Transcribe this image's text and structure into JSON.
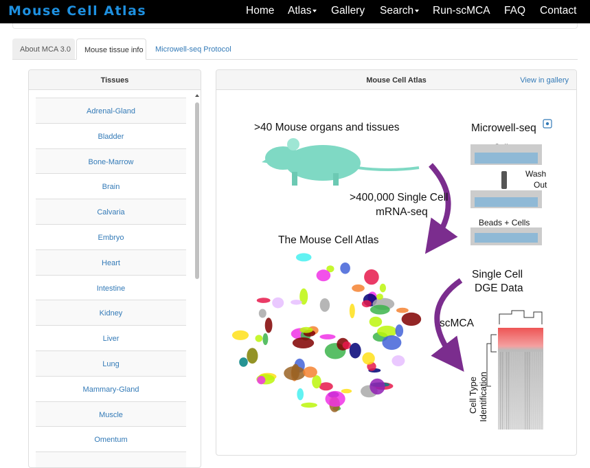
{
  "navbar": {
    "brand": "Mouse Cell Atlas",
    "items": [
      {
        "label": "Home",
        "dropdown": false
      },
      {
        "label": "Atlas",
        "dropdown": true
      },
      {
        "label": "Gallery",
        "dropdown": false
      },
      {
        "label": "Search",
        "dropdown": true
      },
      {
        "label": "Run-scMCA",
        "dropdown": false
      },
      {
        "label": "FAQ",
        "dropdown": false
      },
      {
        "label": "Contact",
        "dropdown": false
      }
    ]
  },
  "tabs": [
    {
      "label": "About MCA 3.0",
      "active": false
    },
    {
      "label": "Mouse tissue info",
      "active": true
    },
    {
      "label": "Microwell-seq Protocol",
      "active": false
    }
  ],
  "tissues_panel": {
    "title": "Tissues",
    "items": [
      "Adrenal-Gland",
      "Bladder",
      "Bone-Marrow",
      "Brain",
      "Calvaria",
      "Embryo",
      "Heart",
      "Intestine",
      "Kidney",
      "Liver",
      "Lung",
      "Mammary-Gland",
      "Muscle",
      "Omentum"
    ]
  },
  "atlas_panel": {
    "title": "Mouse Cell Atlas",
    "gallery_link": "View in gallery",
    "figure": {
      "organs_label": ">40 Mouse organs and tissues",
      "microwell_title": "Microwell-seq",
      "step_cells": "Cells",
      "step_wash_1": "Wash",
      "step_wash_2": "Out",
      "step_beads": "Beads + Cells",
      "single_cell_1": ">400,000 Single Cell",
      "single_cell_2": "mRNA-seq",
      "atlas_label": "The Mouse Cell Atlas",
      "dge_1": "Single Cell",
      "dge_2": "DGE Data",
      "scmca": "scMCA",
      "celltype_1": "Cell Type",
      "celltype_2": "Identification"
    }
  },
  "colors": {
    "navbar_bg": "#000000",
    "brand": "#1e90e0",
    "link": "#337ab7",
    "mouse": "#7fd9c4",
    "arrow": "#7b2d8e",
    "well": "#8fb9d6"
  }
}
